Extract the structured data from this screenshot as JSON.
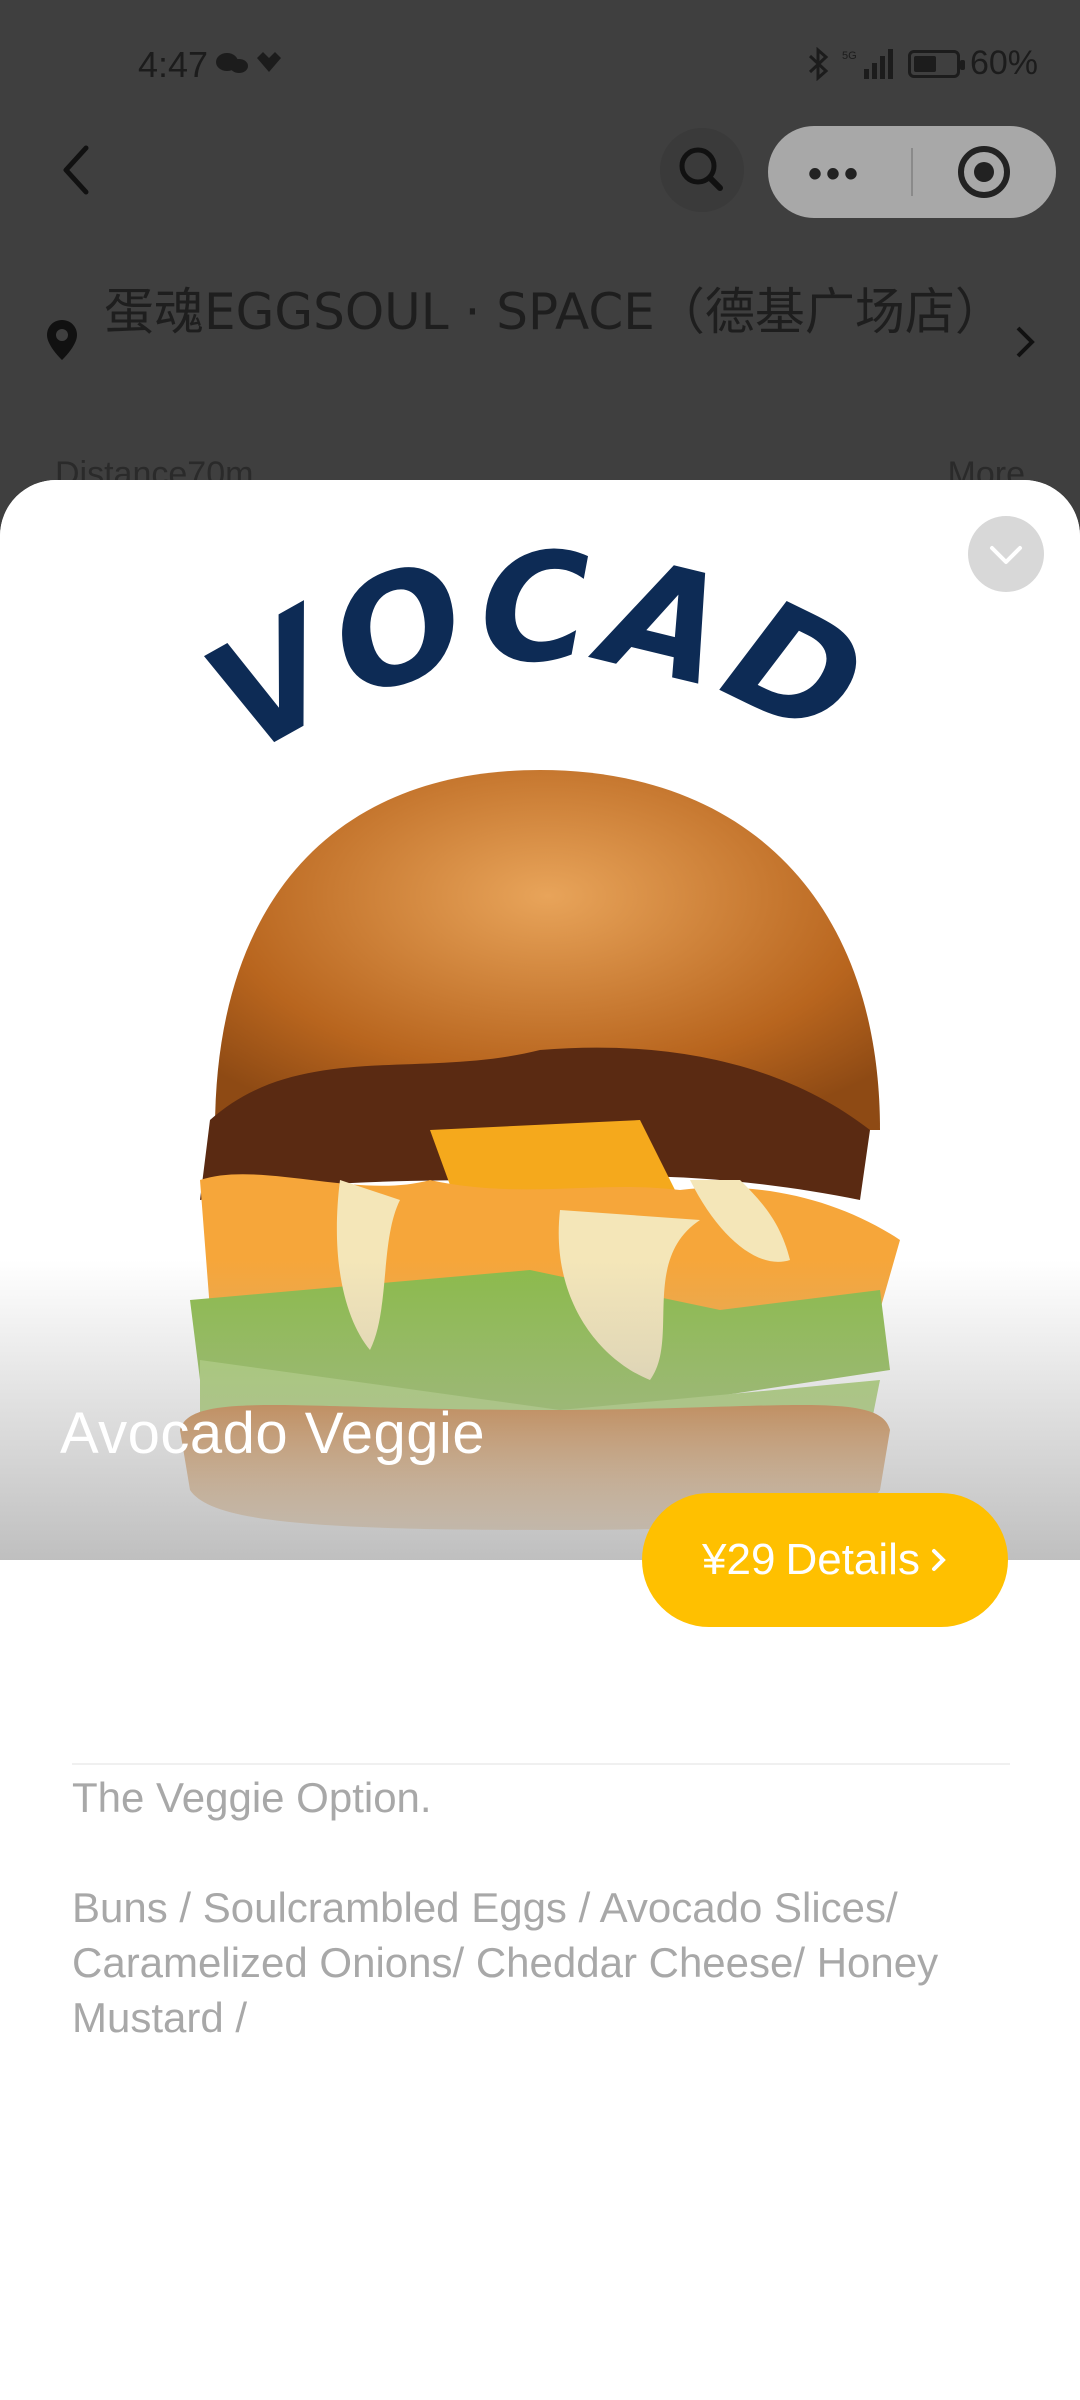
{
  "status_bar": {
    "time": "4:47",
    "battery": "60%",
    "battery_level": 0.6
  },
  "header": {
    "store_name": "蛋魂EGGSOUL · SPACE（德基广场店）"
  },
  "background_row": {
    "distance": "Distance70m",
    "more": "More"
  },
  "product": {
    "logo_text": "AVOCADO",
    "name": "Avocado Veggie",
    "price": "¥29",
    "details_label": "Details",
    "description": "The Veggie Option.\n\nBuns / Soulcrambled Eggs / Avocado Slices/ Caramelized Onions/ Cheddar Cheese/ Honey Mustard /"
  },
  "colors": {
    "accent": "#ffc000",
    "logo_navy": "#0d2b55",
    "overlay": "#3f3f3f"
  },
  "icons": [
    "back-icon",
    "search-icon",
    "more-dots-icon",
    "target-icon",
    "location-pin-icon",
    "chevron-right-icon",
    "chevron-down-icon"
  ]
}
